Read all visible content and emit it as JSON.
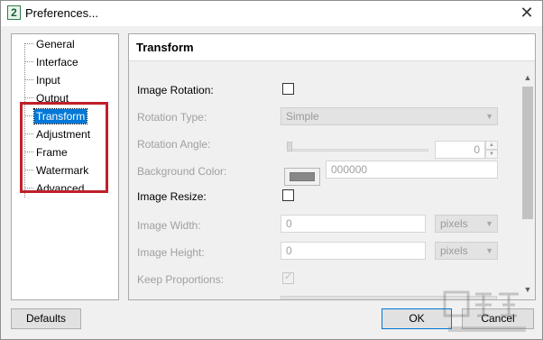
{
  "window": {
    "title": "Preferences...",
    "app_icon_glyph": "2"
  },
  "tree": {
    "items": [
      {
        "label": "General"
      },
      {
        "label": "Interface"
      },
      {
        "label": "Input"
      },
      {
        "label": "Output"
      },
      {
        "label": "Transform",
        "selected": true
      },
      {
        "label": "Adjustment"
      },
      {
        "label": "Frame"
      },
      {
        "label": "Watermark"
      },
      {
        "label": "Advanced"
      }
    ]
  },
  "panel": {
    "title": "Transform",
    "image_rotation_label": "Image Rotation:",
    "image_rotation_checked": false,
    "rotation_type_label": "Rotation Type:",
    "rotation_type_value": "Simple",
    "rotation_angle_label": "Rotation Angle:",
    "rotation_angle_value": "0",
    "background_color_label": "Background Color:",
    "background_color_value": "000000",
    "image_resize_label": "Image Resize:",
    "image_resize_checked": false,
    "image_width_label": "Image Width:",
    "image_width_value": "0",
    "image_width_unit": "pixels",
    "image_height_label": "Image Height:",
    "image_height_value": "0",
    "image_height_unit": "pixels",
    "keep_proportions_label": "Keep Proportions:",
    "keep_proportions_checked": true
  },
  "buttons": {
    "defaults": "Defaults",
    "ok": "OK",
    "cancel": "Cancel"
  },
  "colors": {
    "selection": "#0078d7",
    "highlight_box": "#c0202a"
  }
}
